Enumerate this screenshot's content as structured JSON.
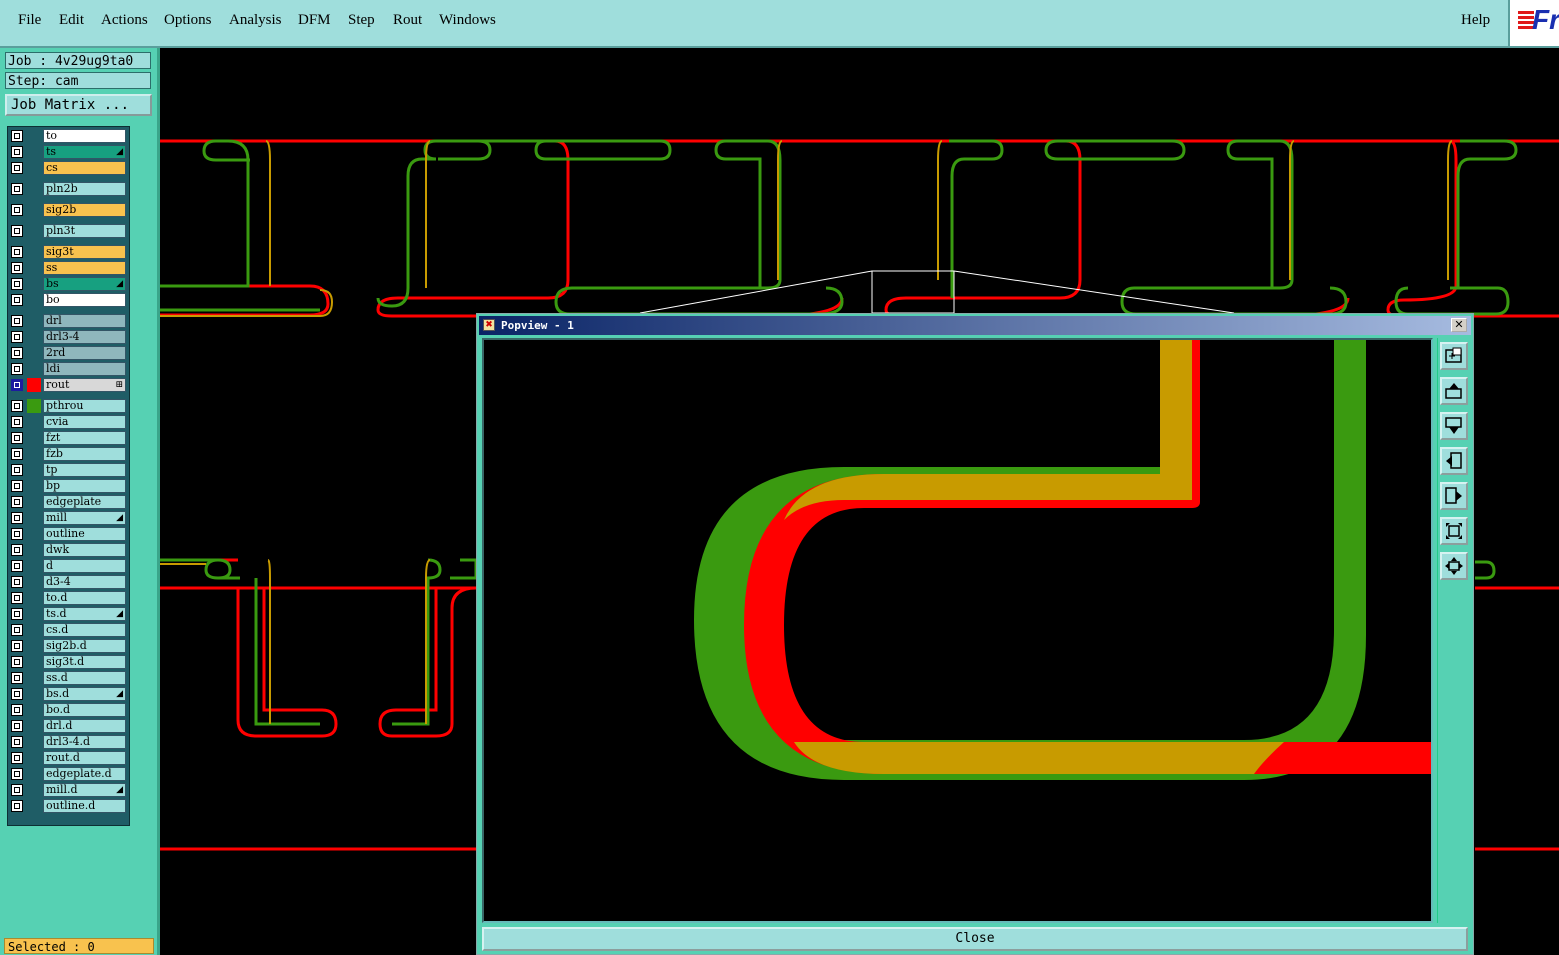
{
  "menubar": {
    "items": [
      "File",
      "Edit",
      "Actions",
      "Options",
      "Analysis",
      "DFM",
      "Step",
      "Rout",
      "Windows"
    ],
    "help": "Help",
    "logo_text": "Fr"
  },
  "left_panel": {
    "job": "Job : 4v29ug9ta0",
    "step": "Step: cam",
    "job_matrix_label": "Job Matrix ...",
    "selected_text": "Selected : 0"
  },
  "layers": [
    {
      "name": "to",
      "color": "#ffffff",
      "swatch": null,
      "mark": ""
    },
    {
      "name": "ts",
      "color": "#17a080",
      "swatch": null,
      "mark": "◢"
    },
    {
      "name": "cs",
      "color": "#f8c24e",
      "swatch": null,
      "mark": ""
    },
    {
      "name": "pln2b",
      "color": "#9fdedc",
      "swatch": null,
      "mark": ""
    },
    {
      "name": "sig2b",
      "color": "#f8c24e",
      "swatch": null,
      "mark": ""
    },
    {
      "name": "pln3t",
      "color": "#9fdedc",
      "swatch": null,
      "mark": ""
    },
    {
      "name": "sig3t",
      "color": "#f8c24e",
      "swatch": null,
      "mark": ""
    },
    {
      "name": "ss",
      "color": "#f8c24e",
      "swatch": null,
      "mark": ""
    },
    {
      "name": "bs",
      "color": "#17a080",
      "swatch": null,
      "mark": "◢"
    },
    {
      "name": "bo",
      "color": "#ffffff",
      "swatch": null,
      "mark": ""
    },
    {
      "name": "drl",
      "color": "#8fb7bd",
      "swatch": null,
      "mark": ""
    },
    {
      "name": "drl3-4",
      "color": "#8fb7bd",
      "swatch": null,
      "mark": ""
    },
    {
      "name": "2rd",
      "color": "#8fb7bd",
      "swatch": null,
      "mark": ""
    },
    {
      "name": "ldi",
      "color": "#8fb7bd",
      "swatch": null,
      "mark": ""
    },
    {
      "name": "rout",
      "color": "#d8d8d8",
      "swatch": "#ff0000",
      "mark": "⊞",
      "selected": true
    },
    {
      "name": "pthrou",
      "color": "#9fdedc",
      "swatch": "#3a9a10",
      "mark": ""
    },
    {
      "name": "cvia",
      "color": "#9fdedc",
      "swatch": null,
      "mark": ""
    },
    {
      "name": "fzt",
      "color": "#9fdedc",
      "swatch": null,
      "mark": ""
    },
    {
      "name": "fzb",
      "color": "#9fdedc",
      "swatch": null,
      "mark": ""
    },
    {
      "name": "tp",
      "color": "#9fdedc",
      "swatch": null,
      "mark": ""
    },
    {
      "name": "bp",
      "color": "#9fdedc",
      "swatch": null,
      "mark": ""
    },
    {
      "name": "edgeplate",
      "color": "#9fdedc",
      "swatch": null,
      "mark": ""
    },
    {
      "name": "mill",
      "color": "#9fdedc",
      "swatch": null,
      "mark": "◢"
    },
    {
      "name": "outline",
      "color": "#9fdedc",
      "swatch": null,
      "mark": ""
    },
    {
      "name": "dwk",
      "color": "#9fdedc",
      "swatch": null,
      "mark": ""
    },
    {
      "name": "d",
      "color": "#9fdedc",
      "swatch": null,
      "mark": ""
    },
    {
      "name": "d3-4",
      "color": "#9fdedc",
      "swatch": null,
      "mark": ""
    },
    {
      "name": "to.d",
      "color": "#9fdedc",
      "swatch": null,
      "mark": ""
    },
    {
      "name": "ts.d",
      "color": "#9fdedc",
      "swatch": null,
      "mark": "◢"
    },
    {
      "name": "cs.d",
      "color": "#9fdedc",
      "swatch": null,
      "mark": ""
    },
    {
      "name": "sig2b.d",
      "color": "#9fdedc",
      "swatch": null,
      "mark": ""
    },
    {
      "name": "sig3t.d",
      "color": "#9fdedc",
      "swatch": null,
      "mark": ""
    },
    {
      "name": "ss.d",
      "color": "#9fdedc",
      "swatch": null,
      "mark": ""
    },
    {
      "name": "bs.d",
      "color": "#9fdedc",
      "swatch": null,
      "mark": "◢"
    },
    {
      "name": "bo.d",
      "color": "#9fdedc",
      "swatch": null,
      "mark": ""
    },
    {
      "name": "drl.d",
      "color": "#9fdedc",
      "swatch": null,
      "mark": ""
    },
    {
      "name": "drl3-4.d",
      "color": "#9fdedc",
      "swatch": null,
      "mark": ""
    },
    {
      "name": "rout.d",
      "color": "#9fdedc",
      "swatch": null,
      "mark": ""
    },
    {
      "name": "edgeplate.d",
      "color": "#9fdedc",
      "swatch": null,
      "mark": ""
    },
    {
      "name": "mill.d",
      "color": "#9fdedc",
      "swatch": null,
      "mark": "◢"
    },
    {
      "name": "outline.d",
      "color": "#9fdedc",
      "swatch": null,
      "mark": ""
    }
  ],
  "popview": {
    "title": "Popview - 1",
    "close_label": "Close",
    "tools": [
      "zoom-window-icon",
      "pan-up-icon",
      "pan-down-icon",
      "pan-left-icon",
      "pan-right-icon",
      "zoom-fit-icon",
      "zoom-home-icon"
    ]
  },
  "colors": {
    "rout": "#ff0000",
    "pthrou": "#3a9a10",
    "overlap": "#c89b00",
    "panel": "#56d1b3",
    "menubar": "#9fdedc"
  }
}
